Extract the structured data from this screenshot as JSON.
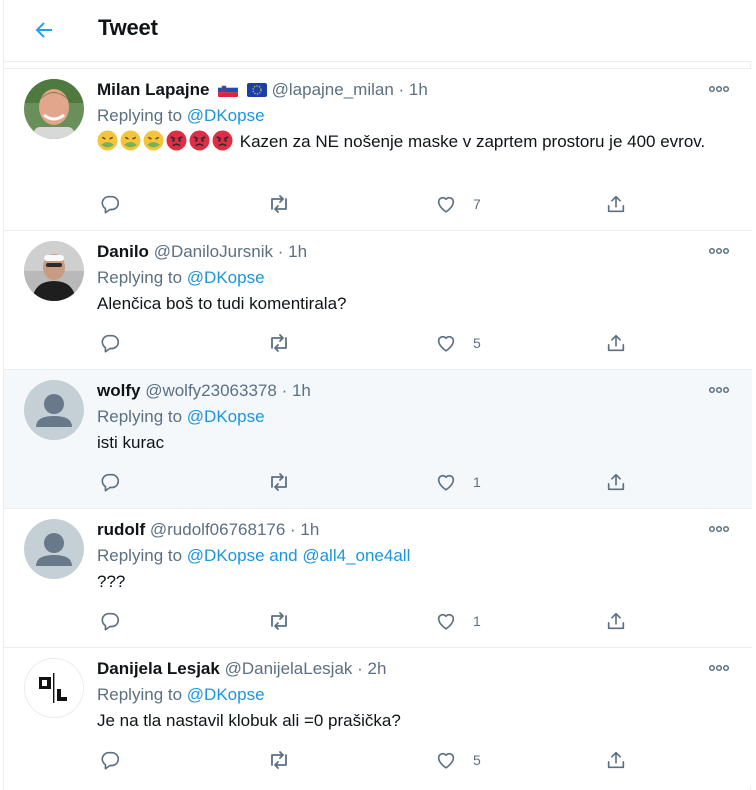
{
  "header": {
    "title": "Tweet",
    "back_icon": "arrow-left-icon",
    "accent": "#1da1f2"
  },
  "colors": {
    "link": "#1b95e0",
    "muted": "#5b7083",
    "hover_bg": "#f5f8fa"
  },
  "replies": [
    {
      "name": "Milan Lapajne",
      "handle": "@lapajne_milan",
      "time": "· 1h",
      "flags": [
        "slovenia-flag-icon",
        "eu-flag-icon"
      ],
      "replying_label": "Replying to",
      "mentions": "@DKopse",
      "emojis": [
        "nauseated-face-emoji",
        "nauseated-face-emoji",
        "nauseated-face-emoji",
        "angry-face-emoji",
        "angry-face-emoji",
        "angry-face-emoji"
      ],
      "text": "Kazen za NE nošenje maske v zaprtem prostoru  je 400 evrov.",
      "like_count": "7"
    },
    {
      "name": "Danilo",
      "handle": "@DaniloJursnik",
      "time": "· 1h",
      "replying_label": "Replying to",
      "mentions": "@DKopse",
      "text": "Alenčica boš to tudi komentirala?",
      "like_count": "5"
    },
    {
      "name": "wolfy",
      "handle": "@wolfy23063378",
      "time": "· 1h",
      "replying_label": "Replying to",
      "mentions": "@DKopse",
      "text": "isti kurac",
      "like_count": "1"
    },
    {
      "name": "rudolf",
      "handle": "@rudolf06768176",
      "time": "· 1h",
      "replying_label": "Replying to",
      "mentions": "@DKopse and @all4_one4all",
      "text": "???",
      "like_count": "1"
    },
    {
      "name": "Danijela Lesjak",
      "handle": "@DanijelaLesjak",
      "time": "· 2h",
      "replying_label": "Replying to",
      "mentions": "@DKopse",
      "text": "Je na tla nastavil klobuk ali =0 prašička?",
      "like_count": "5"
    }
  ]
}
